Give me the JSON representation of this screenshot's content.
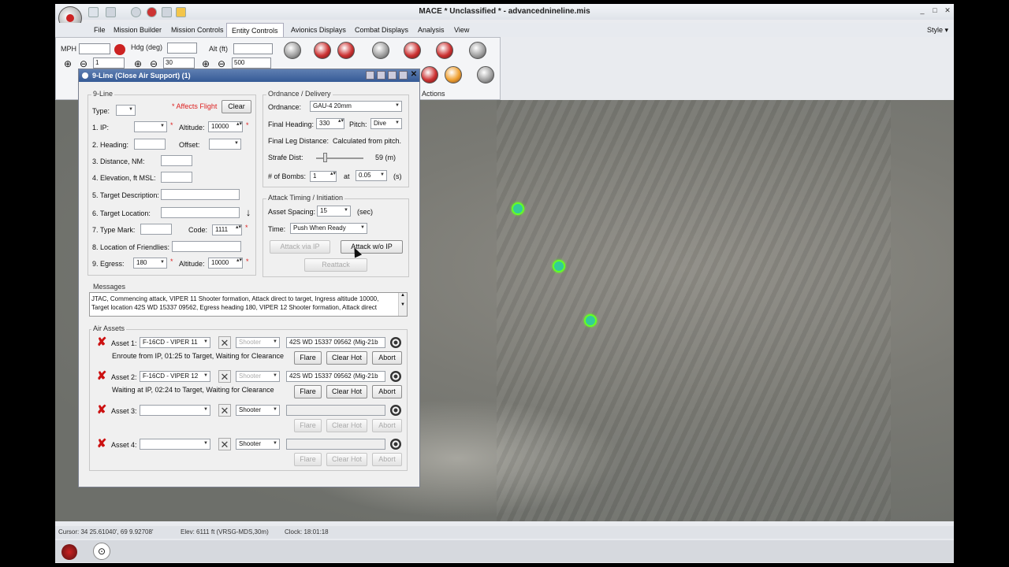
{
  "window": {
    "title": "MACE  * Unclassified * - advancednineline.mis",
    "min": "_",
    "max": "□",
    "close": "✕"
  },
  "menu": [
    "File",
    "Mission Builder",
    "Mission Controls",
    "Entity Controls",
    "Avionics Displays",
    "Combat Displays",
    "Analysis",
    "View"
  ],
  "menu_active": "Entity Controls",
  "style_menu": "Style",
  "ribbon": {
    "mph_label": "MPH",
    "hdg_label": "Hdg (deg)",
    "alt_label": "Alt (ft)",
    "stepper1": "1",
    "stepper2": "30",
    "stepper3": "500",
    "actions_label": "Actions"
  },
  "dialog": {
    "title": "9-Line (Close Air Support) (1)",
    "nineline": {
      "group": "9-Line",
      "type_label": "Type:",
      "affects": "* Affects Flight",
      "clear": "Clear",
      "ip_label": "1. IP:",
      "altitude_label": "Altitude:",
      "altitude": "10000",
      "heading_label": "2. Heading:",
      "offset_label": "Offset:",
      "distance_label": "3. Distance, NM:",
      "elevation_label": "4. Elevation, ft MSL:",
      "target_desc_label": "5. Target Description:",
      "target_loc_label": "6. Target Location:",
      "type_mark_label": "7. Type Mark:",
      "code_label": "Code:",
      "code": "1111",
      "friendlies_label": "8. Location of Friendlies:",
      "egress_label": "9. Egress:",
      "egress": "180",
      "altitude2": "10000"
    },
    "ordnance": {
      "group": "Ordnance / Delivery",
      "ordnance_label": "Ordnance:",
      "ordnance": "GAU-4 20mm",
      "final_heading_label": "Final Heading:",
      "final_heading": "330",
      "pitch_label": "Pitch:",
      "pitch": "Dive",
      "final_leg_label": "Final Leg Distance:",
      "final_leg": "Calculated from pitch.",
      "strafe_label": "Strafe Dist:",
      "strafe_value": "59 (m)",
      "strafe_fraction": 0.15,
      "bombs_label": "# of Bombs:",
      "bombs": "1",
      "at_label": "at",
      "interval": "0.05",
      "interval_unit": "(s)"
    },
    "timing": {
      "group": "Attack Timing / Initiation",
      "spacing_label": "Asset Spacing:",
      "spacing": "15",
      "spacing_unit": "(sec)",
      "time_label": "Time:",
      "time": "Push When Ready",
      "attack_via_ip": "Attack via IP",
      "attack_wo_ip": "Attack w/o IP",
      "reattack": "Reattack"
    },
    "messages": {
      "group": "Messages",
      "line1": "JTAC, Commencing attack, VIPER 11 Shooter formation, Attack direct to target, Ingress altitude 10000,",
      "line2": "Target location 42S WD 15337 09562, Egress heading 180, VIPER 12 Shooter formation, Attack direct"
    },
    "assets": {
      "group": "Air Assets",
      "rows": [
        {
          "label": "Asset 1:",
          "aircraft": "F-16CD - VIPER 11",
          "role": "Shooter",
          "target": "42S WD 15337 09562 (Mig-21b",
          "status": "Enroute from IP, 01:25 to Target, Waiting for Clearance",
          "enabled": true
        },
        {
          "label": "Asset 2:",
          "aircraft": "F-16CD - VIPER 12",
          "role": "Shooter",
          "target": "42S WD 15337 09562 (Mig-21b",
          "status": "Waiting at IP, 02:24 to Target, Waiting for Clearance",
          "enabled": true
        },
        {
          "label": "Asset 3:",
          "aircraft": "",
          "role": "Shooter",
          "target": "",
          "status": "",
          "enabled": false
        },
        {
          "label": "Asset 4:",
          "aircraft": "",
          "role": "Shooter",
          "target": "",
          "status": "",
          "enabled": false
        }
      ],
      "flare": "Flare",
      "clear_hot": "Clear Hot",
      "abort": "Abort"
    }
  },
  "status": {
    "cursor": "Cursor:  34 25.61040', 69 9.92708'",
    "elev": "Elev:  6111 ft (VRSG-MDS,30m)",
    "clock": "Clock:  18:01:18"
  },
  "colors": {
    "dialog_title": "#355a96",
    "marker": "#3c9",
    "abort_x": "#c11"
  }
}
